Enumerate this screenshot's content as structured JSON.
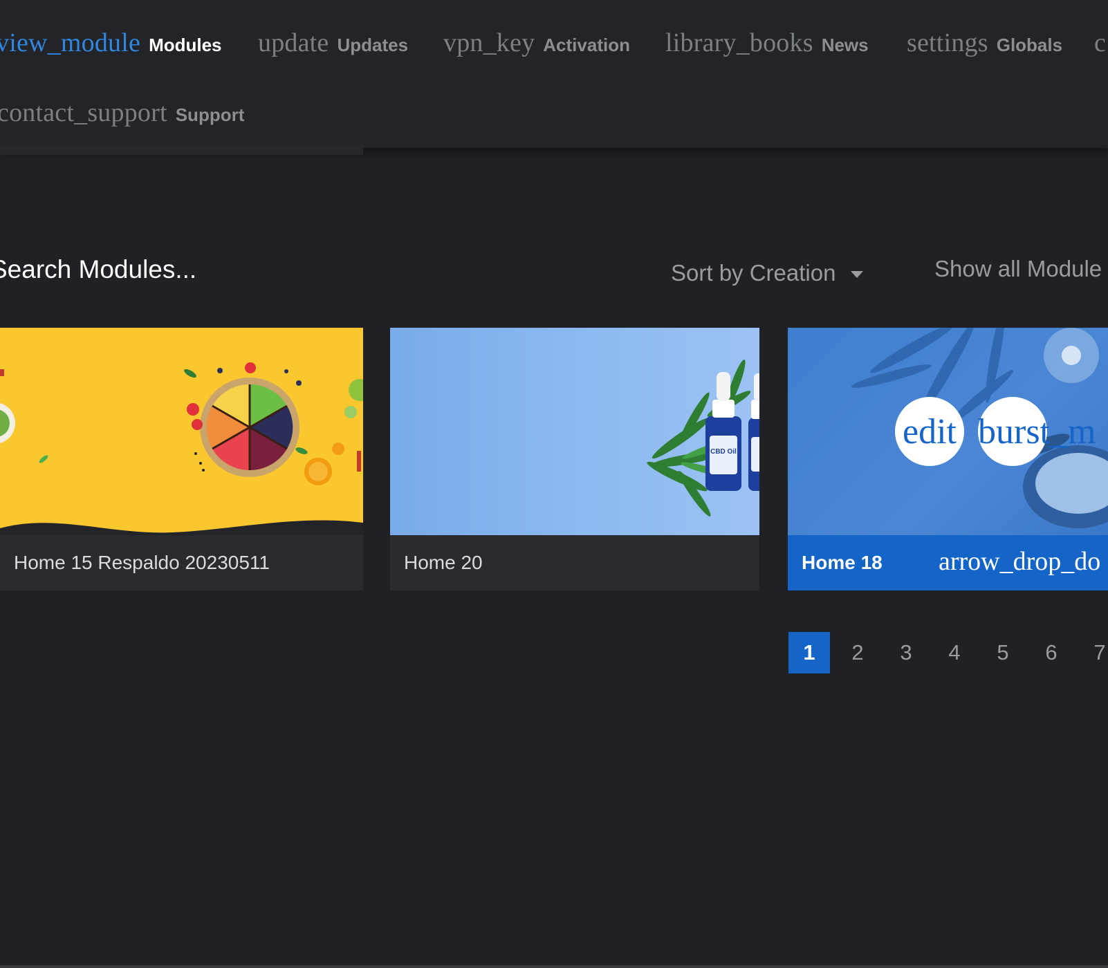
{
  "nav": {
    "items": [
      {
        "icon": "view_module",
        "label": "Modules",
        "active": true
      },
      {
        "icon": "update",
        "label": "Updates",
        "active": false
      },
      {
        "icon": "vpn_key",
        "label": "Activation",
        "active": false
      },
      {
        "icon": "library_books",
        "label": "News",
        "active": false
      },
      {
        "icon": "settings",
        "label": "Globals",
        "active": false
      },
      {
        "icon": "c",
        "label": "",
        "active": false
      },
      {
        "icon": "contact_support",
        "label": "Support",
        "active": false
      }
    ]
  },
  "toolbar": {
    "search_placeholder": "Search Modules...",
    "sort_label": "Sort by Creation",
    "show_all_label": "Show all Module"
  },
  "modules": [
    {
      "title": "Home 15 Respaldo 20230511",
      "active": false
    },
    {
      "title": "Home 20",
      "active": false
    },
    {
      "title": "Home 18",
      "active": true,
      "overlay_actions": [
        "edit",
        "burst_m"
      ],
      "footer_icon": "arrow_drop_do"
    }
  ],
  "pagination": {
    "pages": [
      "1",
      "2",
      "3",
      "4",
      "5",
      "6",
      "7"
    ],
    "current": "1"
  },
  "colors": {
    "background": "#202124",
    "accent": "#1565c8",
    "card_yellow": "#fbc72f",
    "card_blue": "#8dbaf0"
  }
}
